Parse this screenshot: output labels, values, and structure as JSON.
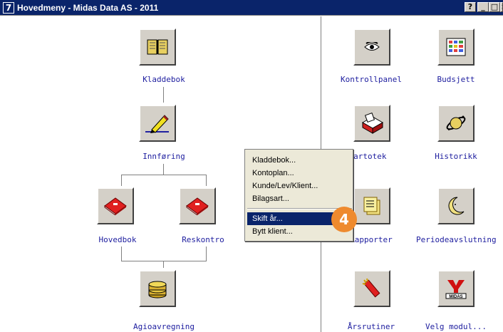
{
  "window": {
    "icon_glyph": "7",
    "title": "Hovedmeny - Midas Data AS - 2011",
    "help_glyph": "?",
    "min_glyph": "_",
    "max_glyph": "□",
    "close_glyph": "×"
  },
  "left_tree": {
    "kladdebok": "Kladdebok",
    "innforing": "Innføring",
    "hovedbok": "Hovedbok",
    "reskontro": "Reskontro",
    "agioavregning": "Agioavregning"
  },
  "right_grid": {
    "kontrollpanel": "Kontrollpanel",
    "budsjett": "Budsjett",
    "kartotek": "Kartotek",
    "historikk": "Historikk",
    "rapporter": "Rapporter",
    "periodeavslutning": "Periodeavslutning",
    "arsrutiner": "Årsrutiner",
    "velg_modul": "Velg modul..."
  },
  "context_menu": {
    "items": [
      "Kladdebok...",
      "Kontoplan...",
      "Kunde/Lev/Klient...",
      "Bilagsart...",
      "Skift år...",
      "Bytt klient..."
    ],
    "selected": "Skift år..."
  },
  "step_badge": "4",
  "logo_text": "MIDAS",
  "colors": {
    "accent": "#0a246a",
    "badge": "#ee8a2e",
    "label": "#2020a0"
  }
}
